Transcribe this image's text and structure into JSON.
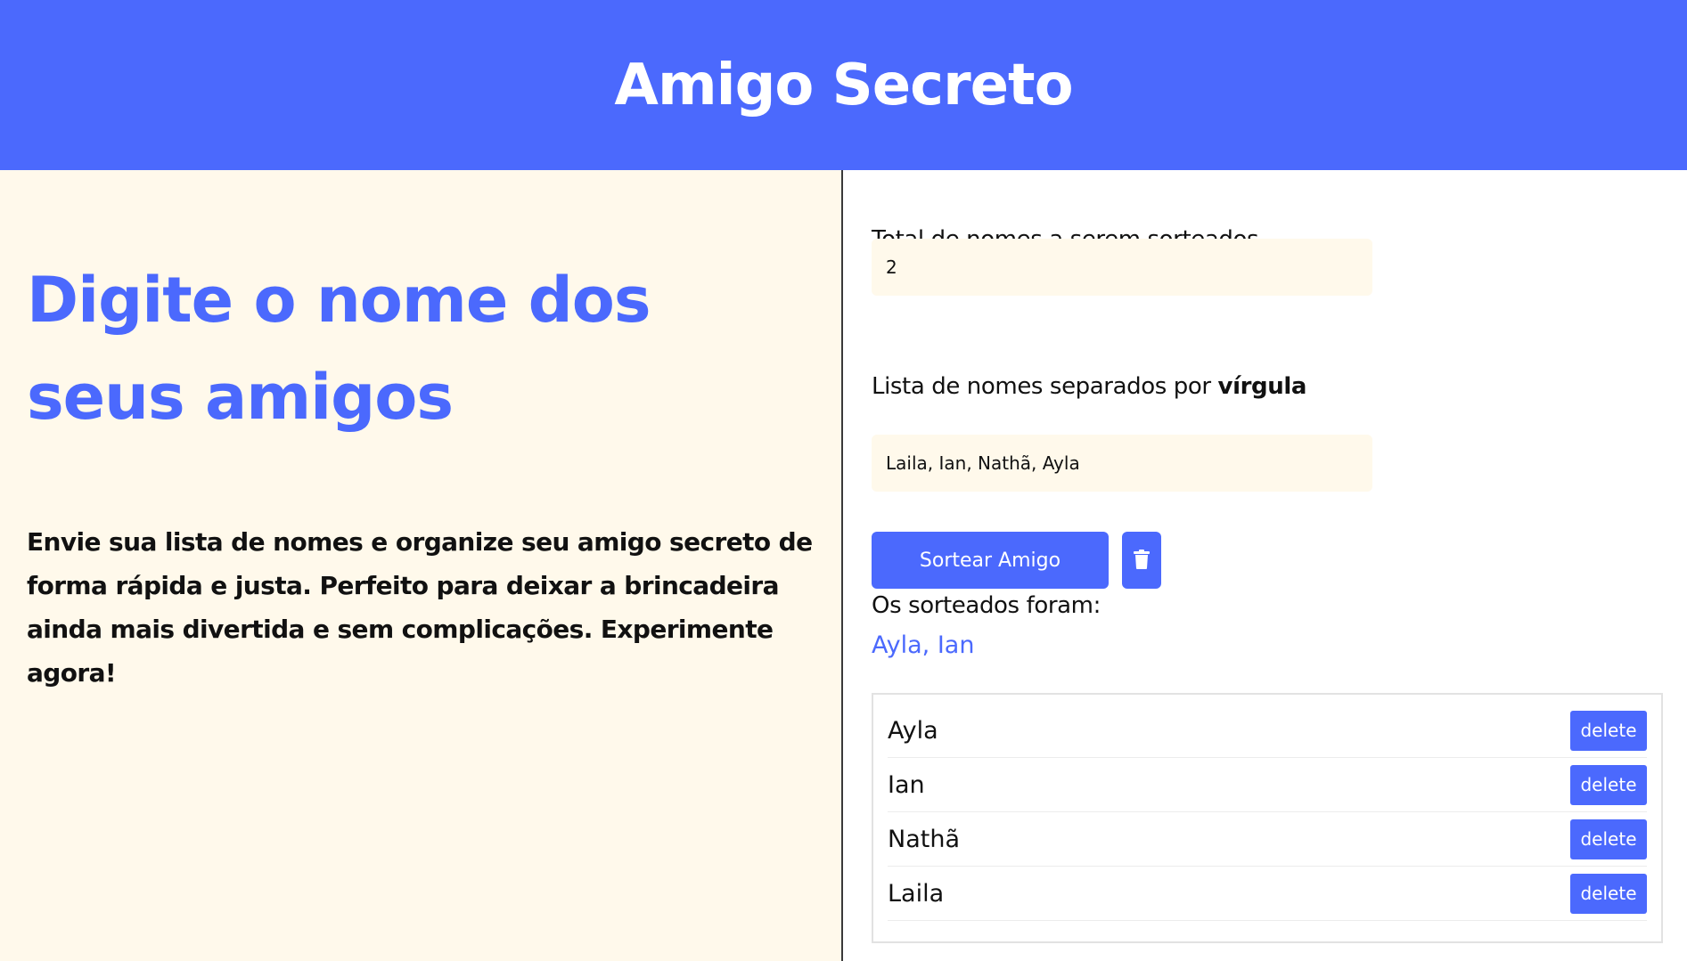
{
  "header": {
    "title": "Amigo Secreto"
  },
  "intro": {
    "heading": "Digite o nome dos seus amigos",
    "description": "Envie sua lista de nomes e organize seu amigo secreto de forma rápida e justa. Perfeito para deixar a brincadeira ainda mais divertida e sem complicações. Experimente agora!"
  },
  "form": {
    "total_label": "Total de nomes a serem sorteados",
    "total_value": "2",
    "list_label_prefix": "Lista de nomes separados por",
    "list_label_bold": "vírgula",
    "list_value": "Laila, Ian, Nathã, Ayla",
    "draw_button": "Sortear Amigo",
    "trash_icon": "trash-icon"
  },
  "results": {
    "title": "Os sorteados foram:",
    "value": "Ayla, Ian"
  },
  "names": [
    {
      "name": "Ayla",
      "action": "delete"
    },
    {
      "name": "Ian",
      "action": "delete"
    },
    {
      "name": "Nathã",
      "action": "delete"
    },
    {
      "name": "Laila",
      "action": "delete"
    }
  ],
  "colors": {
    "accent": "#4b69fd",
    "panel_background": "#fff9eb",
    "text": "#111111"
  }
}
